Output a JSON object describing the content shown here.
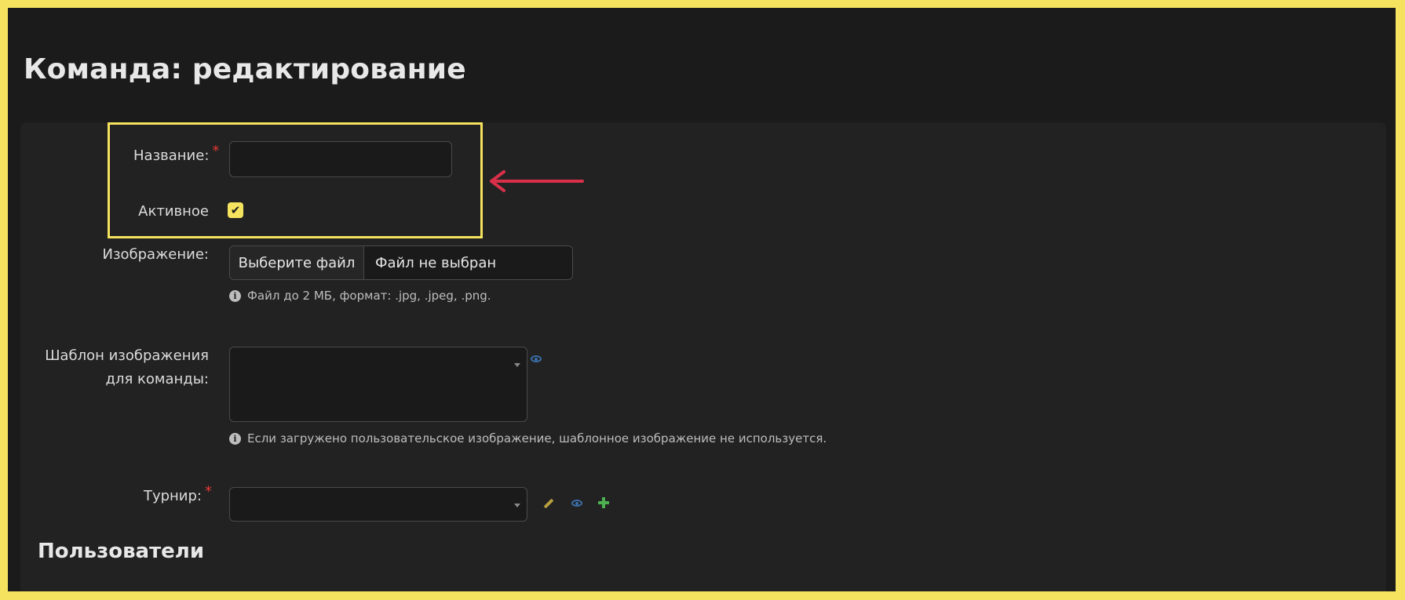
{
  "page": {
    "title": "Команда: редактирование"
  },
  "form": {
    "name": {
      "label": "Название:",
      "required_mark": "*",
      "value": ""
    },
    "active": {
      "label": "Активное",
      "checked": true
    },
    "image": {
      "label": "Изображение:",
      "button_label": "Выберите файл",
      "file_status": "Файл не выбран",
      "hint": "Файл до 2 МБ, формат: .jpg, .jpeg, .png."
    },
    "template": {
      "label_line1": "Шаблон изображения",
      "label_line2": "для команды:",
      "hint": "Если загружено пользовательское изображение, шаблонное изображение не используется."
    },
    "tournament": {
      "label": "Турнир:",
      "required_mark": "*"
    }
  },
  "sections": {
    "users_title": "Пользователи"
  },
  "colors": {
    "highlight": "#f5e35f",
    "arrow": "#d9304a",
    "required": "#e53935",
    "background": "#1b1b1b",
    "card": "#222222"
  },
  "icons": {
    "info": "info-icon",
    "eye": "eye-icon",
    "pencil": "pencil-icon",
    "plus": "plus-icon",
    "check": "check-icon",
    "caret": "chevron-down-icon"
  }
}
